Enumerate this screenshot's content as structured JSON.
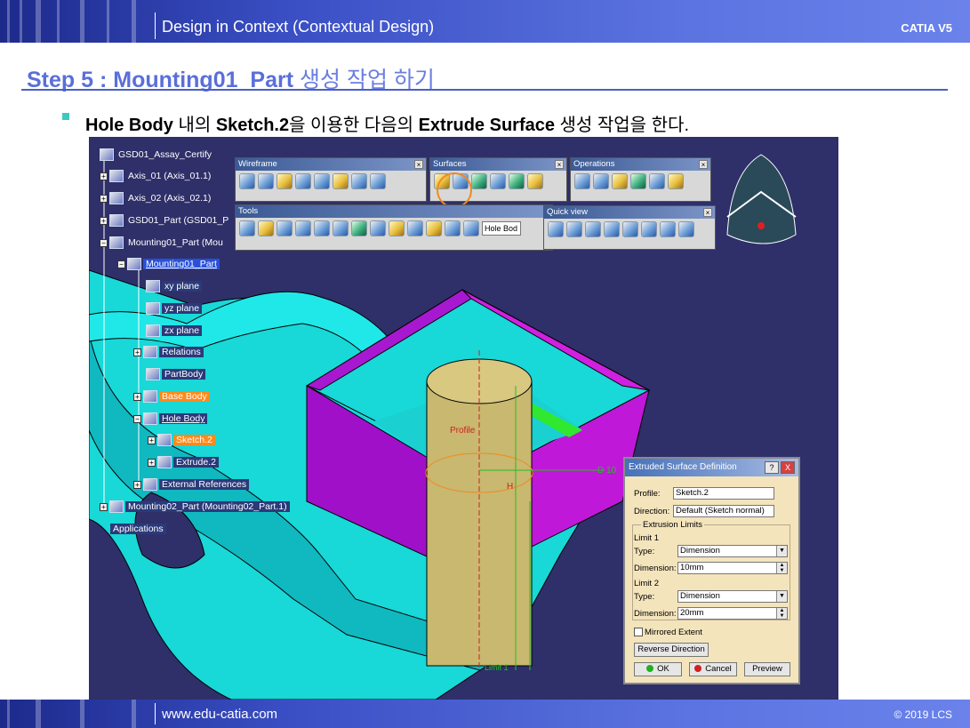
{
  "header": {
    "title": "Design in Context (Contextual Design)",
    "brand": "CATIA V5"
  },
  "step": {
    "prefix": "Step 5 : Mounting01_Part",
    "suffix": " 생성 작업 하기"
  },
  "instruction": {
    "part1": "Hole Body",
    "part2": " 내의 ",
    "part3": "Sketch.2",
    "part4": "을 이용한 다음의 ",
    "part5": "Extrude Surface",
    "part6": " 생성 작업을 한다."
  },
  "tree": {
    "root": "GSD01_Assay_Certify",
    "axis1": "Axis_01 (Axis_01.1)",
    "axis2": "Axis_02 (Axis_02.1)",
    "gsd01": "GSD01_Part (GSD01_P",
    "mounting": "Mounting01_Part (Mou",
    "mounting_part": "Mounting01_Part",
    "xy": "xy plane",
    "yz": "yz plane",
    "zx": "zx plane",
    "relations": "Relations",
    "partbody": "PartBody",
    "basebody": "Base Body",
    "holebody": "Hole Body",
    "sketch2": "Sketch.2",
    "extrude2": "Extrude.2",
    "extref": "External References",
    "mounting02": "Mounting02_Part (Mounting02_Part.1)",
    "applications": "Applications"
  },
  "toolbars": {
    "wireframe": "Wireframe",
    "surfaces": "Surfaces",
    "operations": "Operations",
    "tools": "Tools",
    "quickview": "Quick view",
    "tools_input": "Hole Bod"
  },
  "viewport_labels": {
    "profile": "Profile",
    "d10": "D 10",
    "h": "H",
    "limit": "Limit 1"
  },
  "dialog": {
    "title": "Extruded Surface Definition",
    "profile_label": "Profile:",
    "profile_value": "Sketch.2",
    "direction_label": "Direction:",
    "direction_value": "Default (Sketch normal)",
    "limits_label": "Extrusion Limits",
    "limit1": "Limit 1",
    "limit2": "Limit 2",
    "type_label": "Type:",
    "type1": "Dimension",
    "type2": "Dimension",
    "dim_label": "Dimension:",
    "dim1": "10mm",
    "dim2": "20mm",
    "mirrored": "Mirrored Extent",
    "reverse": "Reverse Direction",
    "ok": "OK",
    "cancel": "Cancel",
    "preview": "Preview",
    "help": "?",
    "close": "X"
  },
  "footer": {
    "url": "www.edu-catia.com",
    "copyright": "© 2019 LCS"
  },
  "colors": {
    "accent": "#5a6fd8",
    "bullet": "#3dc9c1",
    "viewport": "#2f2f6a",
    "highlight": "#ff8a1c"
  }
}
